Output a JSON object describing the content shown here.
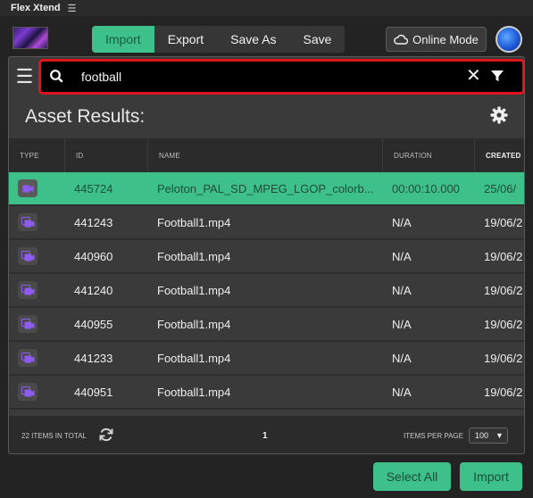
{
  "app": {
    "title": "Flex Xtend"
  },
  "toolbar": {
    "tabs": [
      {
        "label": "Import",
        "active": true
      },
      {
        "label": "Export",
        "active": false
      },
      {
        "label": "Save As",
        "active": false
      },
      {
        "label": "Save",
        "active": false
      }
    ],
    "online_mode_label": "Online Mode"
  },
  "search": {
    "value": "football"
  },
  "results": {
    "title": "Asset Results:"
  },
  "table": {
    "columns": [
      "TYPE",
      "ID",
      "NAME",
      "DURATION",
      "CREATED"
    ],
    "rows": [
      {
        "id": "445724",
        "name": "Peloton_PAL_SD_MPEG_LGOP_colorb...",
        "duration": "00:00:10.000",
        "created": "25/06/",
        "selected": true
      },
      {
        "id": "441243",
        "name": "Football1.mp4",
        "duration": "N/A",
        "created": "19/06/2",
        "selected": false
      },
      {
        "id": "440960",
        "name": "Football1.mp4",
        "duration": "N/A",
        "created": "19/06/2",
        "selected": false
      },
      {
        "id": "441240",
        "name": "Football1.mp4",
        "duration": "N/A",
        "created": "19/06/2",
        "selected": false
      },
      {
        "id": "440955",
        "name": "Football1.mp4",
        "duration": "N/A",
        "created": "19/06/2",
        "selected": false
      },
      {
        "id": "441233",
        "name": "Football1.mp4",
        "duration": "N/A",
        "created": "19/06/2",
        "selected": false
      },
      {
        "id": "440951",
        "name": "Football1.mp4",
        "duration": "N/A",
        "created": "19/06/2",
        "selected": false
      }
    ]
  },
  "footer": {
    "total_label": "22 ITEMS IN TOTAL",
    "page": "1",
    "items_per_page_label": "ITEMS PER PAGE",
    "items_per_page_value": "100"
  },
  "actions": {
    "select_all_label": "Select All",
    "import_label": "Import"
  },
  "colors": {
    "accent": "#3ec08a",
    "search_highlight": "#e0141e",
    "type_icon": "#8e5cf0"
  }
}
